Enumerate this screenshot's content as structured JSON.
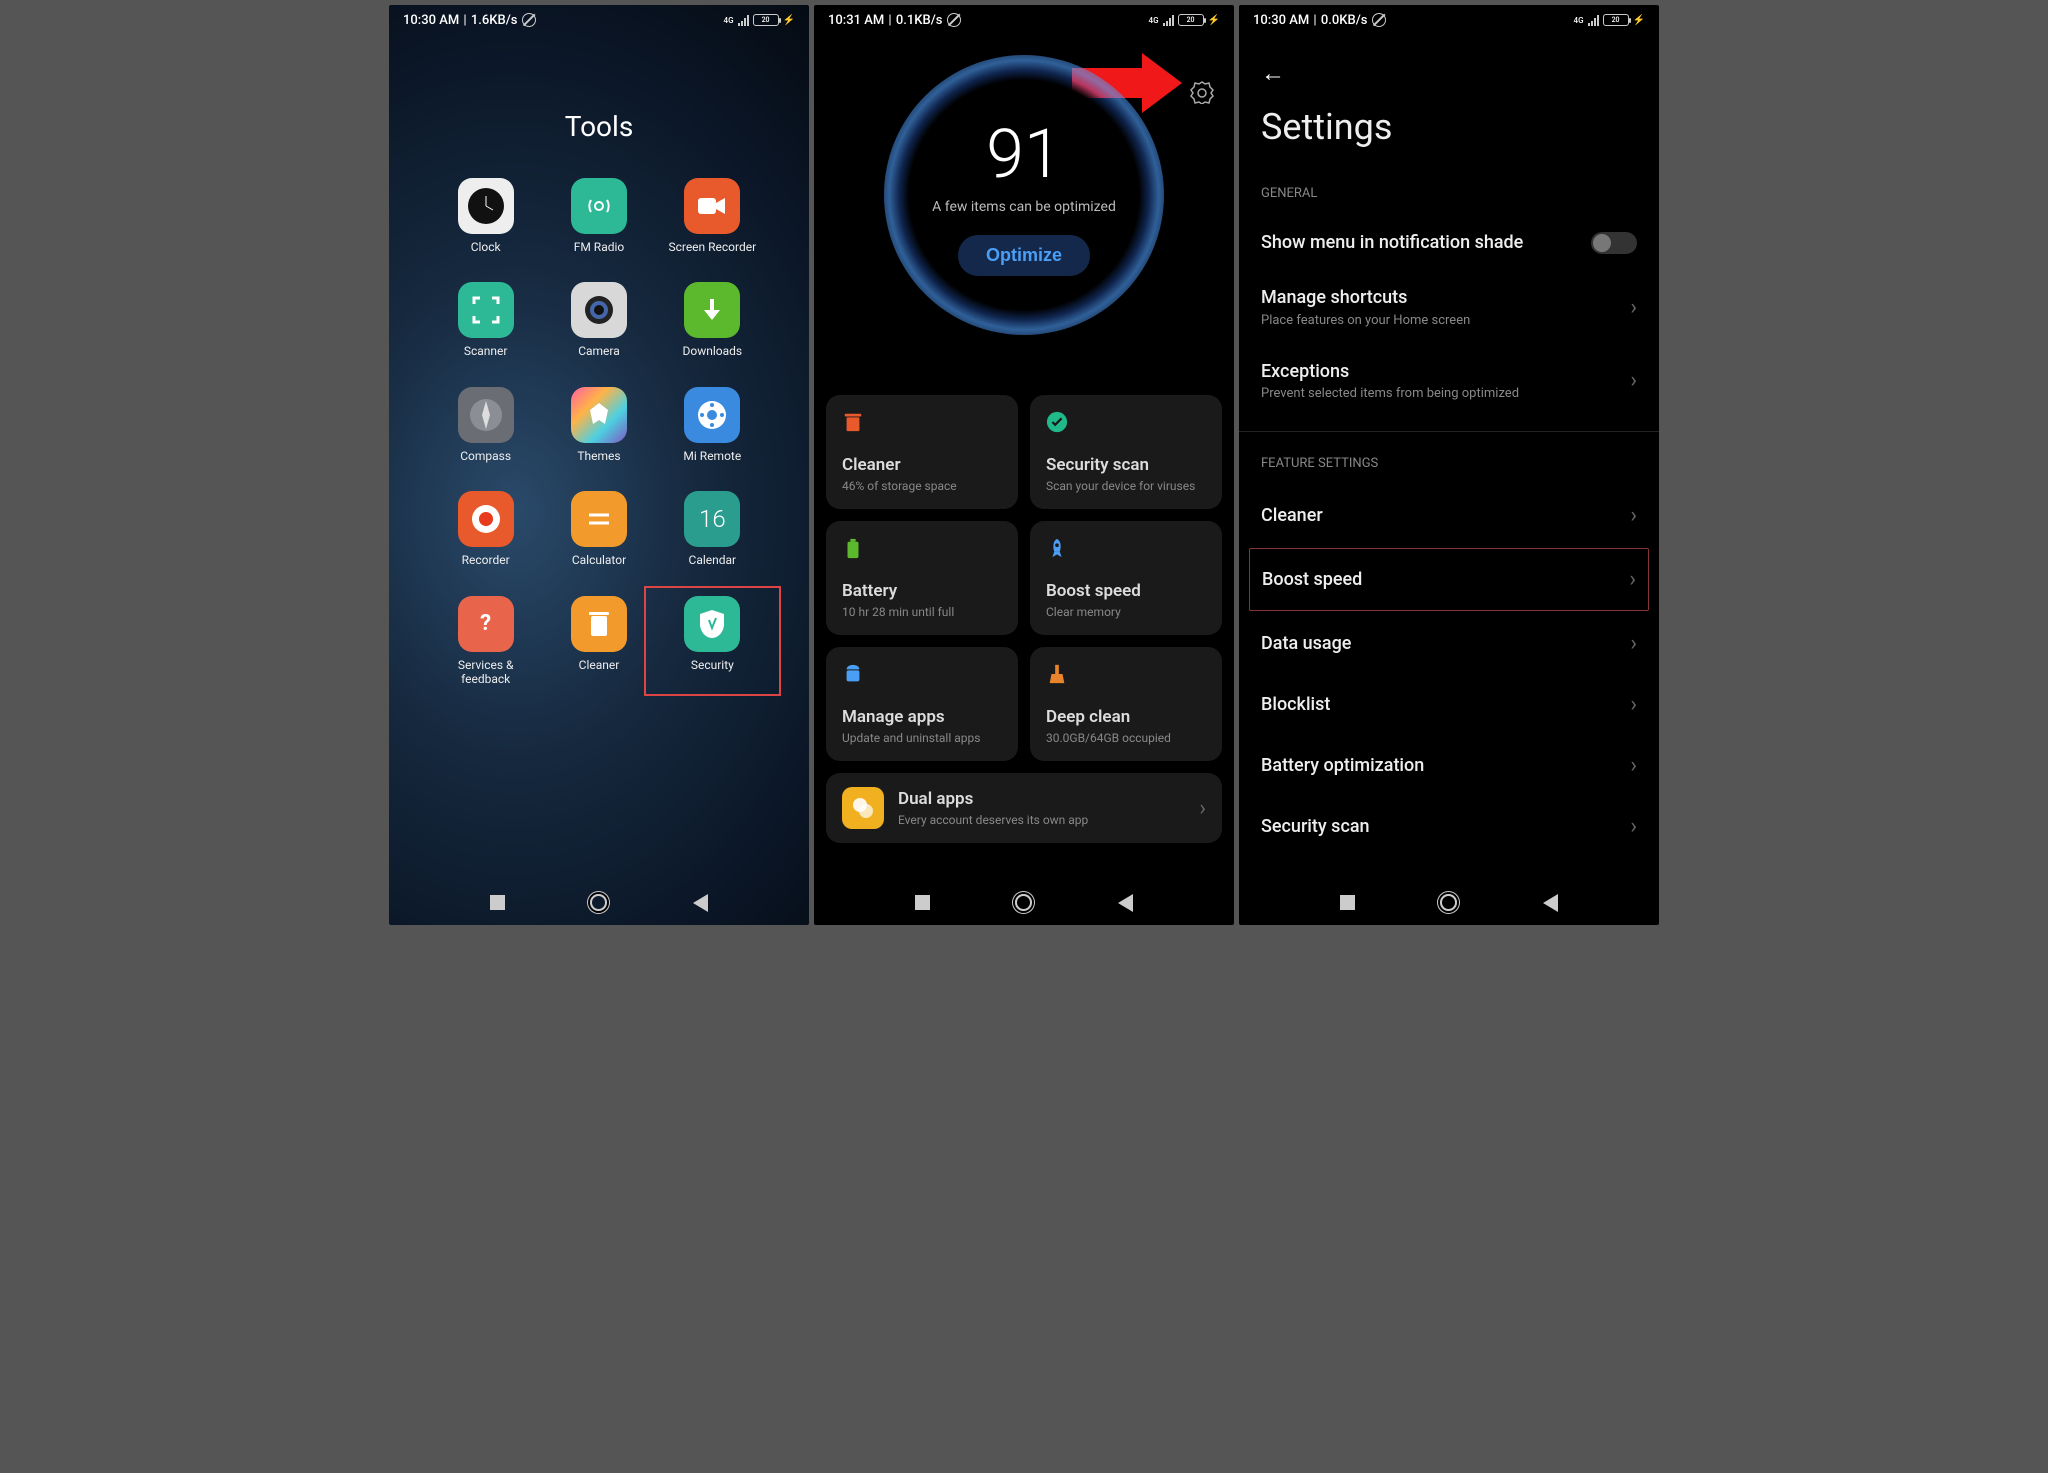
{
  "phone1": {
    "status": {
      "time": "10:30 AM",
      "speed": "1.6KB/s",
      "battery": "20"
    },
    "title": "Tools",
    "apps": [
      {
        "label": "Clock"
      },
      {
        "label": "FM Radio"
      },
      {
        "label": "Screen Recorder"
      },
      {
        "label": "Scanner"
      },
      {
        "label": "Camera"
      },
      {
        "label": "Downloads"
      },
      {
        "label": "Compass"
      },
      {
        "label": "Themes"
      },
      {
        "label": "Mi Remote"
      },
      {
        "label": "Recorder"
      },
      {
        "label": "Calculator"
      },
      {
        "label": "Calendar"
      },
      {
        "label": "Services & feedback"
      },
      {
        "label": "Cleaner"
      },
      {
        "label": "Security"
      }
    ]
  },
  "phone2": {
    "status": {
      "time": "10:31 AM",
      "speed": "0.1KB/s",
      "battery": "20"
    },
    "score": "91",
    "score_text": "A few items can be optimized",
    "optimize": "Optimize",
    "cards": [
      {
        "title": "Cleaner",
        "sub": "46% of storage space"
      },
      {
        "title": "Security scan",
        "sub": "Scan your device for viruses"
      },
      {
        "title": "Battery",
        "sub": "10 hr 28 min  until full"
      },
      {
        "title": "Boost speed",
        "sub": "Clear memory"
      },
      {
        "title": "Manage apps",
        "sub": "Update and uninstall apps"
      },
      {
        "title": "Deep clean",
        "sub": "30.0GB/64GB occupied"
      }
    ],
    "dual": {
      "title": "Dual apps",
      "sub": "Every account deserves its own app"
    }
  },
  "phone3": {
    "status": {
      "time": "10:30 AM",
      "speed": "0.0KB/s",
      "battery": "20"
    },
    "title": "Settings",
    "section_general": "GENERAL",
    "section_feature": "FEATURE SETTINGS",
    "general": [
      {
        "title": "Show menu in notification shade",
        "sub": "",
        "toggle": true
      },
      {
        "title": "Manage shortcuts",
        "sub": "Place features on your Home screen"
      },
      {
        "title": "Exceptions",
        "sub": "Prevent selected items from being optimized"
      }
    ],
    "features": [
      {
        "title": "Cleaner"
      },
      {
        "title": "Boost speed",
        "highlight": true
      },
      {
        "title": "Data usage"
      },
      {
        "title": "Blocklist"
      },
      {
        "title": "Battery optimization"
      },
      {
        "title": "Security scan"
      }
    ]
  }
}
